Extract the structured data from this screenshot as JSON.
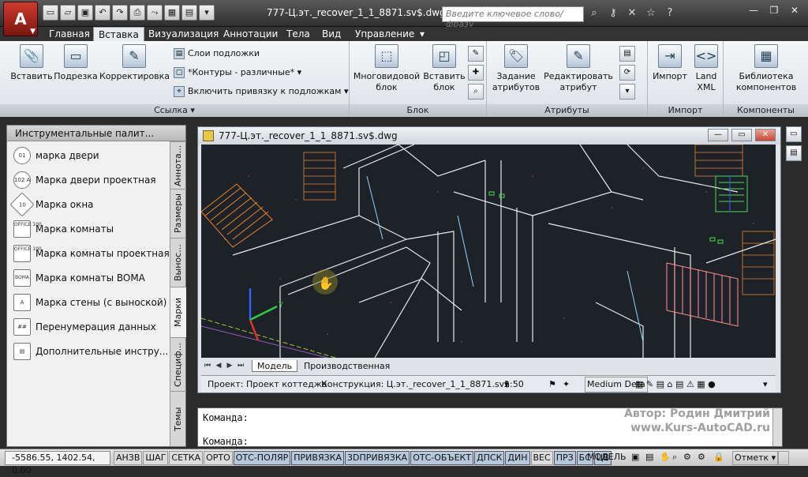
{
  "app": {
    "logo": "A",
    "document_title": "777-Ц.эт._recover_1_1_8871.sv$.dwg"
  },
  "search": {
    "placeholder": "Введите ключевое слово/фразу"
  },
  "ribbon_tabs": [
    "Главная",
    "Вставка",
    "Визуализация",
    "Аннотации",
    "Тела",
    "Вид",
    "Управление"
  ],
  "ribbon_tab_extra": "▾",
  "ribbon": {
    "link_group": {
      "title": "Ссылка ▾",
      "insert": "Вставить",
      "clip": "Подрезка",
      "adjust": "Корректировка",
      "underlay_layers": "Слои подложки",
      "frames": "*Контуры - различные*",
      "snap": "Включить привязку к подложкам"
    },
    "block_group": {
      "title": "Блок",
      "multiview": [
        "Многовидовой",
        "блок"
      ],
      "insert_block": [
        "Вставить",
        "блок"
      ]
    },
    "attributes_group": {
      "title": "Атрибуты",
      "define": [
        "Задание",
        "атрибутов"
      ],
      "edit": [
        "Редактировать",
        "атрибут"
      ]
    },
    "import_group": {
      "title": "Импорт",
      "import": "Импорт",
      "land": [
        "Land",
        "XML"
      ]
    },
    "components_group": {
      "title": "Компоненты",
      "library": [
        "Библиотека",
        "компонентов"
      ]
    }
  },
  "palette": {
    "title": "Инструментальные палит...",
    "items": [
      {
        "label": "марка двери",
        "icon": "01"
      },
      {
        "label": "Марка двери проектная",
        "icon": "102 A"
      },
      {
        "label": "Марка окна",
        "icon": "10"
      },
      {
        "label": "Марка комнаты",
        "icon": "OFFICE 100"
      },
      {
        "label": "Марка комнаты проектная",
        "icon": "OFFICE 100"
      },
      {
        "label": "Марка комнаты BOMA",
        "icon": "BOMA"
      },
      {
        "label": "Марка стены (с выноской)",
        "icon": "A"
      },
      {
        "label": "Перенумерация данных",
        "icon": "##"
      },
      {
        "label": "Дополнительные инстру...",
        "icon": "▤"
      }
    ],
    "tabs": [
      "Аннота...",
      "Размеры",
      "Вынос...",
      "Марки",
      "Специф...",
      "Темы"
    ],
    "active_tab": "Марки"
  },
  "drawing": {
    "title": "777-Ц.эт._recover_1_1_8871.sv$.dwg",
    "model_tab": "Модель",
    "layout_tab": "Производственная",
    "project": "Проект: Проект коттеджа",
    "construction": "Конструкция: Ц.эт._recover_1_1_8871.sv$",
    "scale": "1:50",
    "detail": "Medium Deta"
  },
  "command": {
    "line1": "Команда:",
    "line2": "Команда:"
  },
  "watermark": {
    "author": "Автор: Родин Дмитрий",
    "site": "www.Kurs-AutoCAD.ru"
  },
  "status": {
    "coords": "-5586.55, 1402.54, 0.00",
    "buttons": [
      "АНЗВ",
      "ШАГ",
      "СЕТКА",
      "ОРТО",
      "ОТС-ПОЛЯР",
      "ПРИВЯЗКА",
      "3DПРИВЯЗКА",
      "ОТС-ОБЪЕКТ",
      "ДПСК",
      "ДИН",
      "ВЕС",
      "ПРЗ",
      "БС",
      "ЦВ"
    ],
    "model": "МОДЕЛЬ",
    "annot": "Отметк"
  },
  "colors": {
    "canvas_bg": "#1d2128",
    "accent_red": "#c42b1c",
    "wall_line": "#e8e8e8",
    "hatch_orange": "#e8852a",
    "railing_pink": "#ff8f8f",
    "green_hatch": "#4fdc4f",
    "ucs_red": "#e03030",
    "ucs_green": "#2ecc40",
    "ucs_blue": "#3060ff"
  }
}
